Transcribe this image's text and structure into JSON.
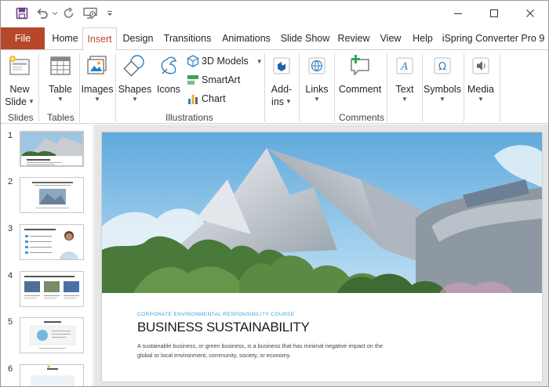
{
  "quick_access": {
    "save_icon": "save-icon",
    "undo_icon": "undo-icon",
    "redo_icon": "redo-icon",
    "present_icon": "present-from-beginning-icon",
    "customize_icon": "customize-qat-icon"
  },
  "window_controls": {
    "minimize": "minimize-icon",
    "maximize": "maximize-icon",
    "close": "close-icon"
  },
  "tabs": [
    {
      "label": "File"
    },
    {
      "label": "Home"
    },
    {
      "label": "Insert"
    },
    {
      "label": "Design"
    },
    {
      "label": "Transitions"
    },
    {
      "label": "Animations"
    },
    {
      "label": "Slide Show"
    },
    {
      "label": "Review"
    },
    {
      "label": "View"
    },
    {
      "label": "Help"
    },
    {
      "label": "iSpring Converter Pro 9"
    }
  ],
  "active_tab": "Insert",
  "colors": {
    "file_tab": "#b7472a",
    "accent_blue": "#3c9ed8"
  },
  "ribbon": {
    "slides": {
      "new_slide_line1": "New",
      "new_slide_line2": "Slide",
      "group": "Slides"
    },
    "tables": {
      "table": "Table",
      "group": "Tables"
    },
    "images": {
      "images": "Images"
    },
    "illustrations": {
      "shapes": "Shapes",
      "icons": "Icons",
      "models_3d": "3D Models",
      "smartart": "SmartArt",
      "chart": "Chart",
      "group": "Illustrations"
    },
    "addins": {
      "line1": "Add-",
      "line2": "ins"
    },
    "links": {
      "links": "Links"
    },
    "comments": {
      "comment": "Comment",
      "group": "Comments"
    },
    "text": {
      "text": "Text"
    },
    "symbols": {
      "symbols": "Symbols"
    },
    "media": {
      "media": "Media"
    }
  },
  "thumbnails": [
    {
      "number": "1"
    },
    {
      "number": "2"
    },
    {
      "number": "3"
    },
    {
      "number": "4"
    },
    {
      "number": "5"
    },
    {
      "number": "6"
    }
  ],
  "slide": {
    "kicker": "CORPORATE ENVIRONMENTAL RESPONSIBILITY COURSE",
    "title": "BUSINESS SUSTAINABILITY",
    "body": "A sustainable business, or green business, is a business that has minimal negative impact on the global or local environment, community, society, or economy."
  }
}
